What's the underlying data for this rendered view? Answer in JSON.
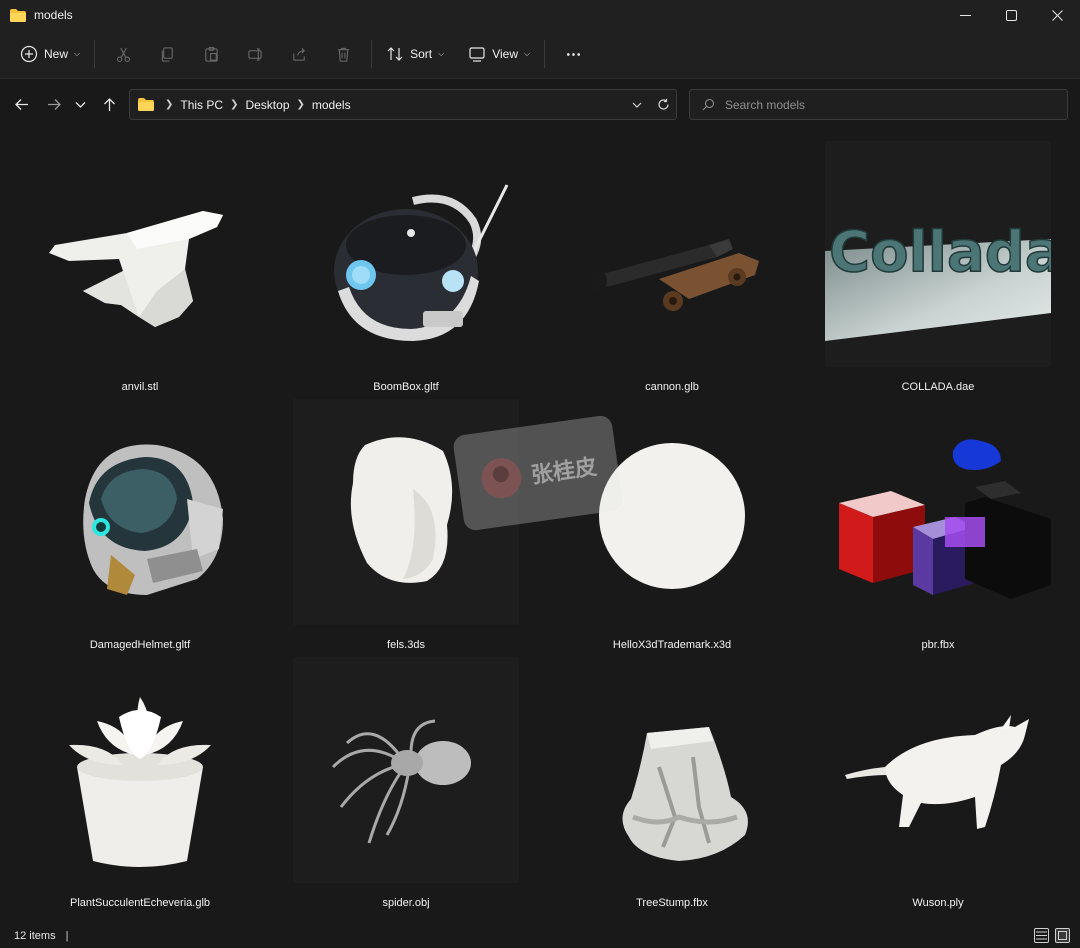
{
  "window": {
    "title": "models"
  },
  "toolbar": {
    "new_label": "New",
    "sort_label": "Sort",
    "view_label": "View"
  },
  "breadcrumb": [
    "This PC",
    "Desktop",
    "models"
  ],
  "search": {
    "placeholder": "Search models"
  },
  "files": [
    {
      "name": "anvil.stl",
      "icon": "anvil-thumbnail"
    },
    {
      "name": "BoomBox.gltf",
      "icon": "boombox-thumbnail"
    },
    {
      "name": "cannon.glb",
      "icon": "cannon-thumbnail"
    },
    {
      "name": "COLLADA.dae",
      "icon": "collada-thumbnail",
      "text": "Collada"
    },
    {
      "name": "DamagedHelmet.gltf",
      "icon": "helmet-thumbnail"
    },
    {
      "name": "fels.3ds",
      "icon": "rock-thumbnail"
    },
    {
      "name": "HelloX3dTrademark.x3d",
      "icon": "sphere-thumbnail"
    },
    {
      "name": "pbr.fbx",
      "icon": "pbr-cubes-thumbnail"
    },
    {
      "name": "PlantSucculentEcheveria.glb",
      "icon": "succulent-thumbnail"
    },
    {
      "name": "spider.obj",
      "icon": "spider-thumbnail"
    },
    {
      "name": "TreeStump.fbx",
      "icon": "treestump-thumbnail"
    },
    {
      "name": "Wuson.ply",
      "icon": "ox-thumbnail"
    }
  ],
  "status": {
    "item_count": "12 items"
  },
  "watermark": {
    "text": "张桂皮"
  },
  "colors": {
    "background": "#191919",
    "chrome": "#202020",
    "folder": "#f3c33b"
  }
}
